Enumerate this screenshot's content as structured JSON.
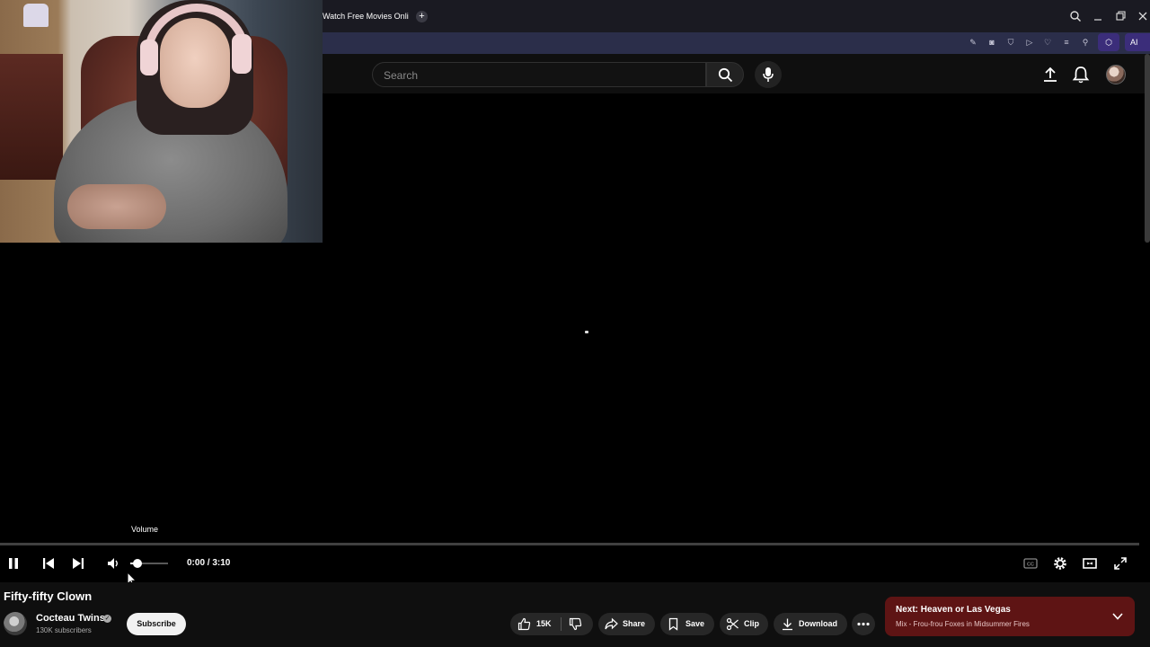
{
  "browser": {
    "tab_title": "Watch Free Movies Online",
    "new_tab_icon": "plus-icon",
    "window_controls": [
      "search-icon",
      "minimize-icon",
      "restore-icon",
      "close-icon"
    ],
    "toolbar_icons": [
      "edit-icon",
      "camera-icon",
      "shield-icon",
      "play-icon",
      "heart-icon",
      "list-icon",
      "person-icon",
      "cube-icon"
    ],
    "ai_label": "AI"
  },
  "header": {
    "search_placeholder": "Search",
    "icons": [
      "search-icon",
      "mic-icon",
      "upload-icon",
      "bell-icon",
      "avatar"
    ]
  },
  "player": {
    "tooltip": "Volume",
    "time": "0:00 / 3:10",
    "progress": 0.0,
    "volume": 0.2,
    "controls": [
      "pause-icon",
      "previous-icon",
      "next-icon",
      "volume-icon",
      "captions-icon",
      "settings-icon",
      "theater-icon",
      "fullscreen-icon"
    ]
  },
  "video": {
    "title": "Fifty-fifty Clown",
    "channel": "Cocteau Twins",
    "subscribers": "130K subscribers",
    "subscribe_label": "Subscribe",
    "likes": "15K",
    "share_label": "Share",
    "save_label": "Save",
    "clip_label": "Clip",
    "download_label": "Download"
  },
  "up_next": {
    "title": "Next: Heaven or Las Vegas",
    "subtitle": "Mix - Frou-frou Foxes in Midsummer Fires"
  },
  "colors": {
    "background": "#000000",
    "toolbar": "#2b2e4a",
    "pill": "#272727",
    "next_card": "#5e1414"
  }
}
